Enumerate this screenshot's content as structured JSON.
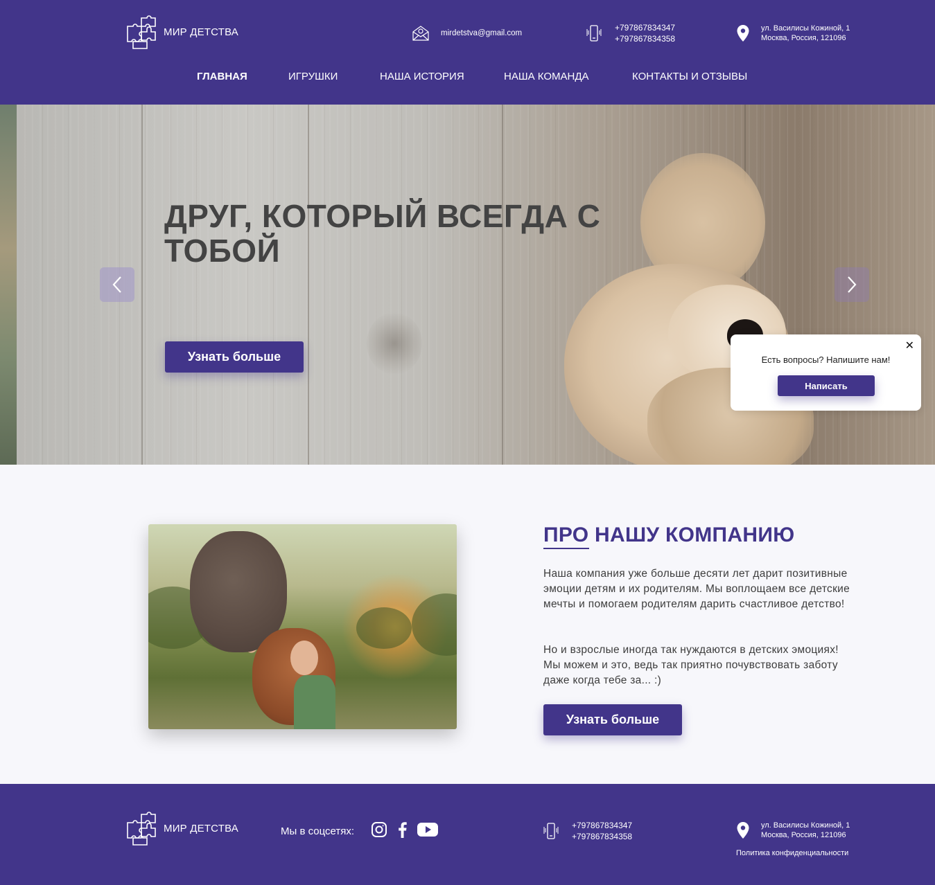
{
  "header": {
    "logo_text": "МИР ДЕТСТВА",
    "email": "mirdetstva@gmail.com",
    "phones": [
      "+797867834347",
      "+797867834358"
    ],
    "address": [
      "ул. Василисы Кожиной, 1",
      "Москва, Россия, 121096"
    ],
    "nav": [
      {
        "label": "ГЛАВНАЯ",
        "active": true
      },
      {
        "label": "ИГРУШКИ",
        "active": false
      },
      {
        "label": "НАША ИСТОРИЯ",
        "active": false
      },
      {
        "label": "НАША КОМАНДА",
        "active": false
      },
      {
        "label": "КОНТАКТЫ И ОТЗЫВЫ",
        "active": false
      }
    ]
  },
  "hero": {
    "title": "ДРУГ, КОТОРЫЙ ВСЕГДА С ТОБОЙ",
    "button": "Узнать больше"
  },
  "chat": {
    "close": "✕",
    "text": "Есть вопросы? Напишите нам!",
    "button": "Написать"
  },
  "about": {
    "title": "ПРО НАШУ КОМПАНИЮ",
    "p1": "Наша компания уже больше десяти лет дарит позитивные эмоции детям и их родителям. Мы воплощаем все детские мечты и помогаем родителям дарить счастливое детство!",
    "p2": "Но и взрослые иногда так нуждаются в детских эмоциях! Мы можем и это, ведь так приятно почувствовать заботу даже когда тебе за... :)",
    "button": "Узнать больше"
  },
  "footer": {
    "logo_text": "МИР ДЕТСТВА",
    "social_label": "Мы в соцсетях:",
    "social_icons": [
      "instagram-icon",
      "facebook-icon",
      "youtube-icon"
    ],
    "phones": [
      "+797867834347",
      "+797867834358"
    ],
    "address": [
      "ул. Василисы Кожиной, 1",
      "Москва, Россия, 121096"
    ],
    "policy": "Политика конфиденциальности"
  },
  "colors": {
    "brand": "#42358a",
    "background": "#f7f7fb",
    "hero_title": "#434343"
  }
}
